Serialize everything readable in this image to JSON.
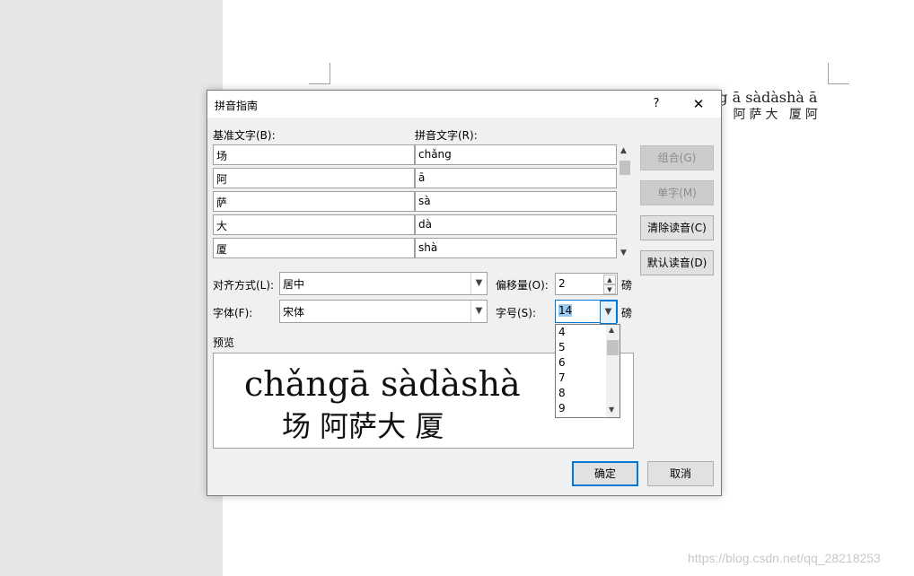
{
  "document": {
    "pinyin_line": "ng ā sàdàshà ā",
    "hanzi_line": "场 阿萨大 厦阿",
    "watermark": "https://blog.csdn.net/qq_28218253"
  },
  "dialog": {
    "title": "拼音指南",
    "help_label": "?",
    "close_label": "✕",
    "base_text_label": "基准文字(B):",
    "pinyin_text_label": "拼音文字(R):",
    "rows": [
      {
        "base": "场",
        "pinyin": "chǎng"
      },
      {
        "base": "阿",
        "pinyin": "ā"
      },
      {
        "base": "萨",
        "pinyin": "sà"
      },
      {
        "base": "大",
        "pinyin": "dà"
      },
      {
        "base": "厦",
        "pinyin": "shà"
      }
    ],
    "buttons": {
      "combine": "组合(G)",
      "single": "单字(M)",
      "clear": "清除读音(C)",
      "default": "默认读音(D)",
      "ok": "确定",
      "cancel": "取消"
    },
    "align_label": "对齐方式(L):",
    "align_value": "居中",
    "offset_label": "偏移量(O):",
    "offset_value": "2",
    "offset_unit": "磅",
    "font_label": "字体(F):",
    "font_value": "宋体",
    "size_label": "字号(S):",
    "size_value": "14",
    "size_unit": "磅",
    "size_options": [
      "4",
      "5",
      "6",
      "7",
      "8",
      "9"
    ],
    "preview_label": "预览",
    "preview_pinyin": "chǎngā sàdàshà",
    "preview_hanzi": "场  阿萨大 厦"
  }
}
